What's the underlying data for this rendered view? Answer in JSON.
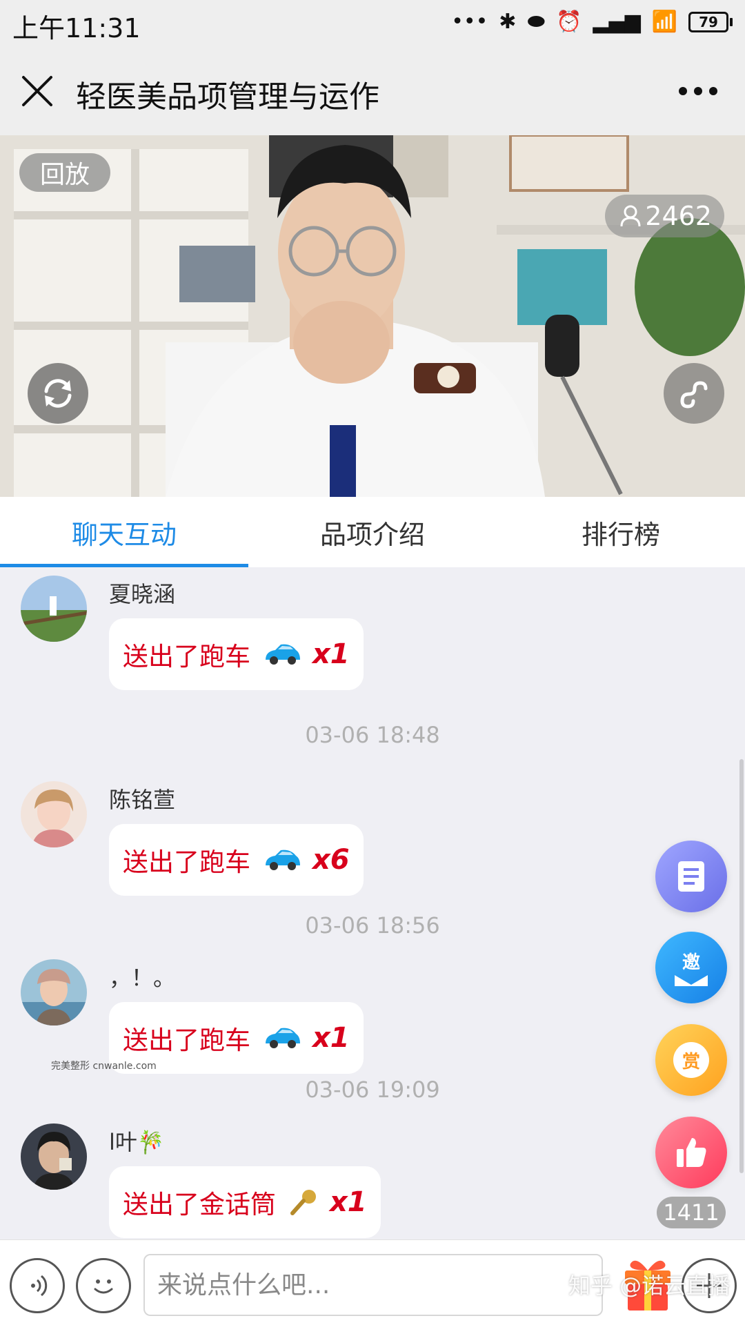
{
  "status_bar": {
    "time": "上午11:31",
    "battery": "79"
  },
  "header": {
    "title": "轻医美品项管理与运作"
  },
  "video": {
    "replay_label": "回放",
    "viewer_count": "2462"
  },
  "tabs": [
    {
      "label": "聊天互动",
      "active": true
    },
    {
      "label": "品项介绍",
      "active": false
    },
    {
      "label": "排行榜",
      "active": false
    }
  ],
  "chat": {
    "messages": [
      {
        "user": "夏晓涵",
        "gift_text": "送出了跑车",
        "gift_icon": "sports-car-icon",
        "count": "x1"
      },
      {
        "timestamp": "03-06 18:48"
      },
      {
        "user": "陈铭萱",
        "gift_text": "送出了跑车",
        "gift_icon": "sports-car-icon",
        "count": "x6"
      },
      {
        "timestamp": "03-06 18:56"
      },
      {
        "user": "，！。",
        "gift_text": "送出了跑车",
        "gift_icon": "sports-car-icon",
        "count": "x1"
      },
      {
        "timestamp": "03-06 19:09"
      },
      {
        "user": "l叶🎋",
        "gift_text": "送出了金话筒",
        "gift_icon": "microphone-icon",
        "count": "x1"
      }
    ],
    "watermark": "完美整形 cnwanle.com"
  },
  "floating": {
    "invite_label": "邀",
    "reward_label": "赏",
    "like_count": "1411"
  },
  "bottom_bar": {
    "input_placeholder": "来说点什么吧...",
    "watermark": "知乎 @诺云直播"
  },
  "colors": {
    "accent": "#1e8be6",
    "gift_red": "#d8001c",
    "background": "#efeff4"
  }
}
